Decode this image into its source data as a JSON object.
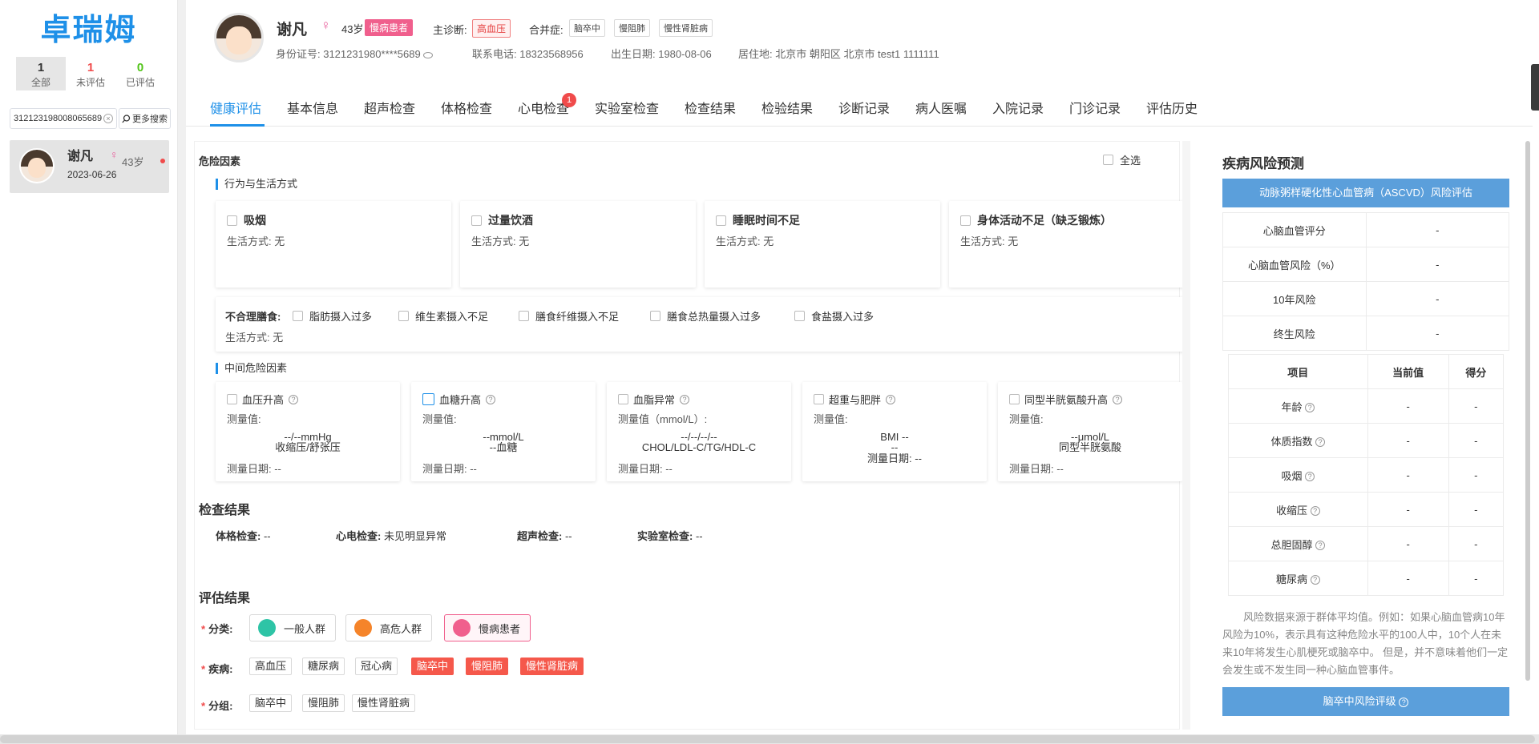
{
  "app": {
    "logo": "卓瑞姆"
  },
  "sidebar": {
    "stats": [
      {
        "num": "1",
        "label": "全部",
        "color": "#333333"
      },
      {
        "num": "1",
        "label": "未评估",
        "color": "#f04b4b"
      },
      {
        "num": "0",
        "label": "已评估",
        "color": "#52c41a"
      }
    ],
    "search_value": "312123198008065689",
    "more_search": "更多搜索",
    "patient": {
      "name": "谢凡",
      "age": "43岁",
      "date": "2023-06-26"
    }
  },
  "header": {
    "name": "谢凡",
    "age": "43岁",
    "tag": "慢病患者",
    "main_dx_label": "主诊断:",
    "main_dx": "高血压",
    "comorb_label": "合并症:",
    "comorbidities": [
      "脑卒中",
      "慢阻肺",
      "慢性肾脏病"
    ],
    "id_card": "身份证号: 3121231980****5689",
    "phone": "联系电话: 18323568956",
    "birth": "出生日期: 1980-08-06",
    "address": "居住地: 北京市 朝阳区 北京市 test1 1111111"
  },
  "tabs": [
    {
      "label": "健康评估"
    },
    {
      "label": "基本信息"
    },
    {
      "label": "超声检查"
    },
    {
      "label": "体格检查"
    },
    {
      "label": "心电检查",
      "badge": "1"
    },
    {
      "label": "实验室检查"
    },
    {
      "label": "检查结果"
    },
    {
      "label": "检验结果"
    },
    {
      "label": "诊断记录"
    },
    {
      "label": "病人医嘱"
    },
    {
      "label": "入院记录"
    },
    {
      "label": "门诊记录"
    },
    {
      "label": "评估历史"
    }
  ],
  "risk": {
    "title": "危险因素",
    "select_all": "全选",
    "behavior_title": "行为与生活方式",
    "behaviors": [
      {
        "name": "吸烟",
        "life": "生活方式: 无"
      },
      {
        "name": "过量饮酒",
        "life": "生活方式: 无"
      },
      {
        "name": "睡眠时间不足",
        "life": "生活方式: 无"
      },
      {
        "name": "身体活动不足（缺乏锻炼）",
        "life": "生活方式: 无"
      }
    ],
    "diet": {
      "label": "不合理膳食:",
      "items": [
        "脂肪摄入过多",
        "维生素摄入不足",
        "膳食纤维摄入不足",
        "膳食总热量摄入过多",
        "食盐摄入过多"
      ],
      "life": "生活方式: 无"
    },
    "middle_title": "中间危险因素",
    "middle": [
      {
        "name": "血压升高",
        "m_label": "测量值:",
        "v1": "--/--mmHg",
        "v2": "收缩压/舒张压",
        "date": "测量日期: --"
      },
      {
        "name": "血糖升高",
        "m_label": "测量值:",
        "v1": "--mmol/L",
        "v2": "--血糖",
        "date": "测量日期: --"
      },
      {
        "name": "血脂异常",
        "m_label": "测量值（mmol/L）:",
        "v1": "--/--/--/--",
        "v2": "CHOL/LDL-C/TG/HDL-C",
        "date": "测量日期: --"
      },
      {
        "name": "超重与肥胖",
        "m_label": "测量值:",
        "v1": "BMI --",
        "v2": "--",
        "date": "测量日期: --"
      },
      {
        "name": "同型半胱氨酸升高",
        "m_label": "测量值:",
        "v1": "--μmol/L",
        "v2": "同型半胱氨酸",
        "date": "测量日期: --"
      }
    ]
  },
  "exam": {
    "title": "检查结果",
    "items": [
      {
        "label": "体格检查:",
        "value": "--"
      },
      {
        "label": "心电检查:",
        "value": "未见明显异常"
      },
      {
        "label": "超声检查:",
        "value": "--"
      },
      {
        "label": "实验室检查:",
        "value": "--"
      }
    ]
  },
  "assess": {
    "title": "评估结果",
    "cat_label": "分类:",
    "categories": [
      {
        "label": "一般人群",
        "color": "#2ec4a6"
      },
      {
        "label": "高危人群",
        "color": "#f5842a"
      },
      {
        "label": "慢病患者",
        "color": "#f05f8d"
      }
    ],
    "disease_label": "疾病:",
    "diseases": [
      {
        "label": "高血压",
        "sel": false
      },
      {
        "label": "糖尿病",
        "sel": false
      },
      {
        "label": "冠心病",
        "sel": false
      },
      {
        "label": "脑卒中",
        "sel": true
      },
      {
        "label": "慢阻肺",
        "sel": true
      },
      {
        "label": "慢性肾脏病",
        "sel": true
      }
    ],
    "group_label": "分组:",
    "groups": [
      "脑卒中",
      "慢阻肺",
      "慢性肾脏病"
    ]
  },
  "prediction": {
    "title": "疾病风险预测",
    "ascvd_head": "动脉粥样硬化性心血管病（ASCVD）风险评估",
    "ascvd_rows": [
      {
        "k": "心脑血管评分",
        "v": "-"
      },
      {
        "k": "心脑血管风险（%）",
        "v": "-"
      },
      {
        "k": "10年风险",
        "v": "-"
      },
      {
        "k": "终生风险",
        "v": "-"
      }
    ],
    "cols": [
      "项目",
      "当前值",
      "得分"
    ],
    "score_rows": [
      {
        "k": "年龄",
        "cur": "-",
        "score": "-"
      },
      {
        "k": "体质指数",
        "cur": "-",
        "score": "-"
      },
      {
        "k": "吸烟",
        "cur": "-",
        "score": "-"
      },
      {
        "k": "收缩压",
        "cur": "-",
        "score": "-"
      },
      {
        "k": "总胆固醇",
        "cur": "-",
        "score": "-"
      },
      {
        "k": "糖尿病",
        "cur": "-",
        "score": "-"
      }
    ],
    "note": "风险数据来源于群体平均值。例如：如果心脑血管病10年 风险为10%，表示具有这种危险水平的100人中，10个人在未来10年将发生心肌梗死或脑卒中。 但是，并不意味着他们一定会发生或不发生同一种心脑血管事件。",
    "stroke_head": "脑卒中风险评级"
  }
}
